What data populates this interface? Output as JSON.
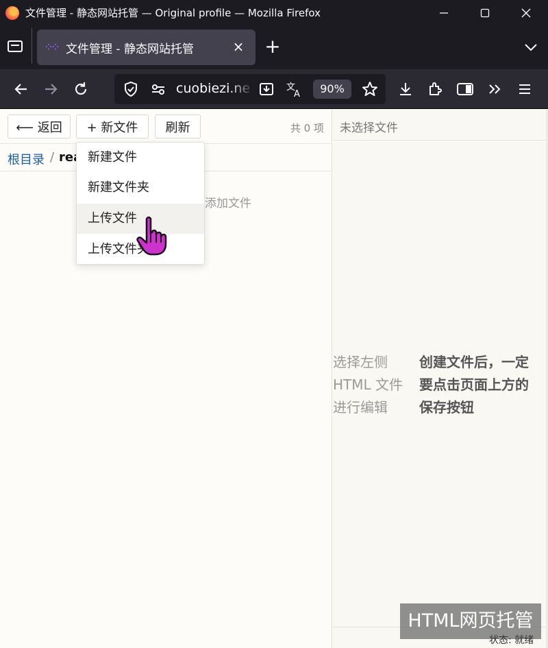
{
  "window": {
    "title": "文件管理 - 静态网站托管 — Original profile — Mozilla Firefox"
  },
  "tab": {
    "title": "文件管理 - 静态网站托管"
  },
  "navbar": {
    "url": "cuobiezi.net",
    "zoom": "90%"
  },
  "toolbar": {
    "back_label": "⟵ 返回",
    "new_file_label": "+ 新文件",
    "refresh_label": "刷新",
    "item_count": "共 0 项"
  },
  "breadcrumb": {
    "root": "根目录",
    "separator": "/",
    "current": "rea"
  },
  "file_list": {
    "empty_hint": "添加文件"
  },
  "dropdown": {
    "items": [
      {
        "label": "新建文件"
      },
      {
        "label": "新建文件夹"
      },
      {
        "label": "上传文件"
      },
      {
        "label": "上传文件夹"
      }
    ],
    "hovered_index": 2
  },
  "editor": {
    "title": "未选择文件",
    "placeholder_lines": [
      "选择左侧",
      "HTML 文件",
      "进行编辑"
    ],
    "notice_lines": [
      "创建文件后，一定",
      "要点击页面上方的",
      "保存按钮"
    ],
    "watermark": "HTML网页托管",
    "status": "状态: 就绪"
  },
  "colors": {
    "titlebar_bg": "#1c1b22",
    "toolbar_bg": "#2b2a33",
    "tab_active_bg": "#42414d",
    "link": "#1f5fa8",
    "cursor": "#cc33cc"
  },
  "icons": [
    "firefox-logo-icon",
    "tabs-list-icon",
    "close-icon",
    "plus-icon",
    "chevron-down-icon",
    "back-arrow-icon",
    "forward-arrow-icon",
    "reload-icon",
    "shield-icon",
    "permissions-icon",
    "install-icon",
    "translate-icon",
    "star-icon",
    "download-icon",
    "extensions-icon",
    "sidebar-icon",
    "overflow-icon",
    "menu-icon",
    "hand-pointer-icon"
  ]
}
